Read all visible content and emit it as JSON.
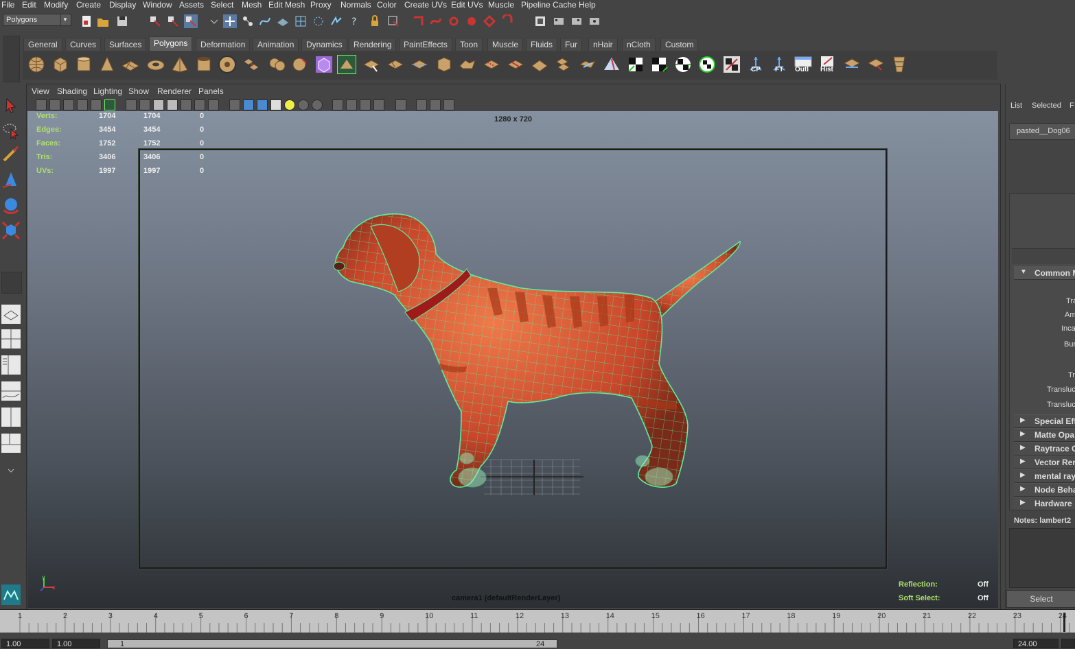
{
  "menubar": [
    "File",
    "Edit",
    "Modify",
    "Create",
    "Display",
    "Window",
    "Assets",
    "Select",
    "Mesh",
    "Edit Mesh",
    "Proxy",
    "Normals",
    "Color",
    "Create UVs",
    "Edit UVs",
    "Muscle",
    "Pipeline Cache",
    "Help"
  ],
  "status_line": {
    "mode": "Polygons"
  },
  "shelf": {
    "tabs": [
      "General",
      "Curves",
      "Surfaces",
      "Polygons",
      "Deformation",
      "Animation",
      "Dynamics",
      "Rendering",
      "PaintEffects",
      "Toon",
      "Muscle",
      "Fluids",
      "Fur",
      "nHair",
      "nCloth",
      "Custom"
    ],
    "active_tab": "Polygons",
    "button_labels": {
      "cp": "CP",
      "ft": "FT",
      "outl": "Outl",
      "hist": "Hist"
    }
  },
  "viewport": {
    "menu": [
      "View",
      "Shading",
      "Lighting",
      "Show",
      "Renderer",
      "Panels"
    ],
    "resolution": "1280 x 720",
    "camera_label": "camera1 (defaultRenderLayer)",
    "stats": [
      {
        "label": "Verts:",
        "a": "1704",
        "b": "1704",
        "c": "0"
      },
      {
        "label": "Edges:",
        "a": "3454",
        "b": "3454",
        "c": "0"
      },
      {
        "label": "Faces:",
        "a": "1752",
        "b": "1752",
        "c": "0"
      },
      {
        "label": "Tris:",
        "a": "3406",
        "b": "3406",
        "c": "0"
      },
      {
        "label": "UVs:",
        "a": "1997",
        "b": "1997",
        "c": "0"
      }
    ],
    "hud_right": [
      {
        "label": "Reflection:",
        "value": "Off"
      },
      {
        "label": "Soft Select:",
        "value": "Off"
      }
    ],
    "axis": {
      "x": "x",
      "y": "y"
    }
  },
  "attribute_editor": {
    "menu": [
      "List",
      "Selected",
      "F"
    ],
    "node_tab": "pasted__Dog06",
    "sections_open": "Common M",
    "attr_labels": [
      "Tra",
      "Am",
      "Inca",
      "Bum",
      "Tr",
      "Transluc",
      "Transluc"
    ],
    "sections_closed": [
      "Special Eff",
      "Matte Opa",
      "Raytrace O",
      "Vector Ren",
      "mental ray",
      "Node Beha",
      "Hardware"
    ],
    "notes_label": "Notes:  lambert2",
    "select_button": "Select"
  },
  "timeline": {
    "ticks": [
      "1",
      "2",
      "3",
      "4",
      "5",
      "6",
      "7",
      "8",
      "9",
      "10",
      "11",
      "12",
      "13",
      "14",
      "15",
      "16",
      "17",
      "18",
      "19",
      "20",
      "21",
      "22",
      "23",
      "24"
    ],
    "range_start": "1.00",
    "playback_start": "1.00",
    "slider_start": "1",
    "slider_end": "24",
    "range_end": "24.00",
    "current": "24"
  },
  "colors": {
    "wire": "#58f0a0",
    "dog": "#d8552e",
    "collar": "#a01a1a"
  }
}
